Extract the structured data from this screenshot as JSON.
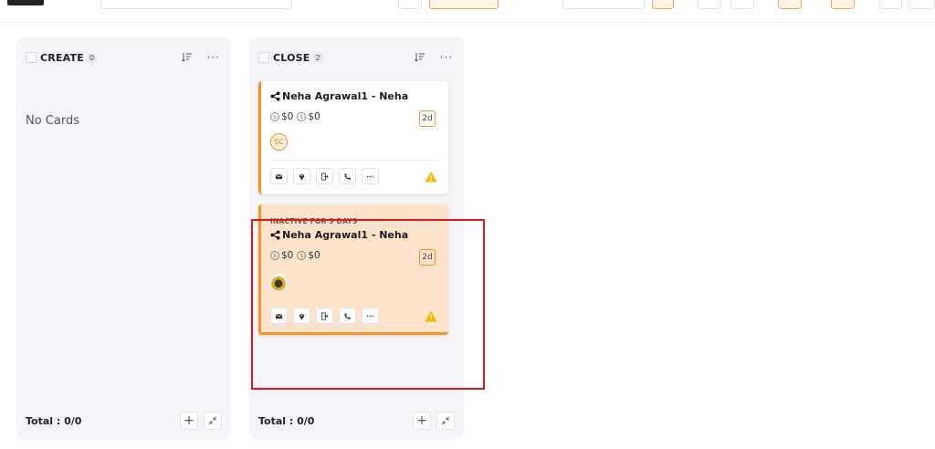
{
  "columns": [
    {
      "title": "CREATE",
      "count": "0",
      "empty_text": "No Cards",
      "total": "Total : 0/0"
    },
    {
      "title": "CLOSE",
      "count": "2",
      "total": "Total : 0/0",
      "cards": [
        {
          "name": "Neha Agrawal1 - Neha",
          "amount1": "$0",
          "amount2": "$0",
          "days": "2d",
          "avatar_initials": "SC"
        },
        {
          "status": "INACTIVE FOR 3 DAYS",
          "name": "Neha Agrawal1 - Neha",
          "amount1": "$0",
          "amount2": "$0",
          "days": "2d"
        }
      ]
    }
  ],
  "icons": {
    "more": "···",
    "add": "+"
  },
  "colors": {
    "accent": "#f7931e",
    "inactive_card_bg": "#fde3cb",
    "highlight": "#e5161b",
    "column_bg": "#f4f5f9",
    "warning": "#f5b800"
  }
}
